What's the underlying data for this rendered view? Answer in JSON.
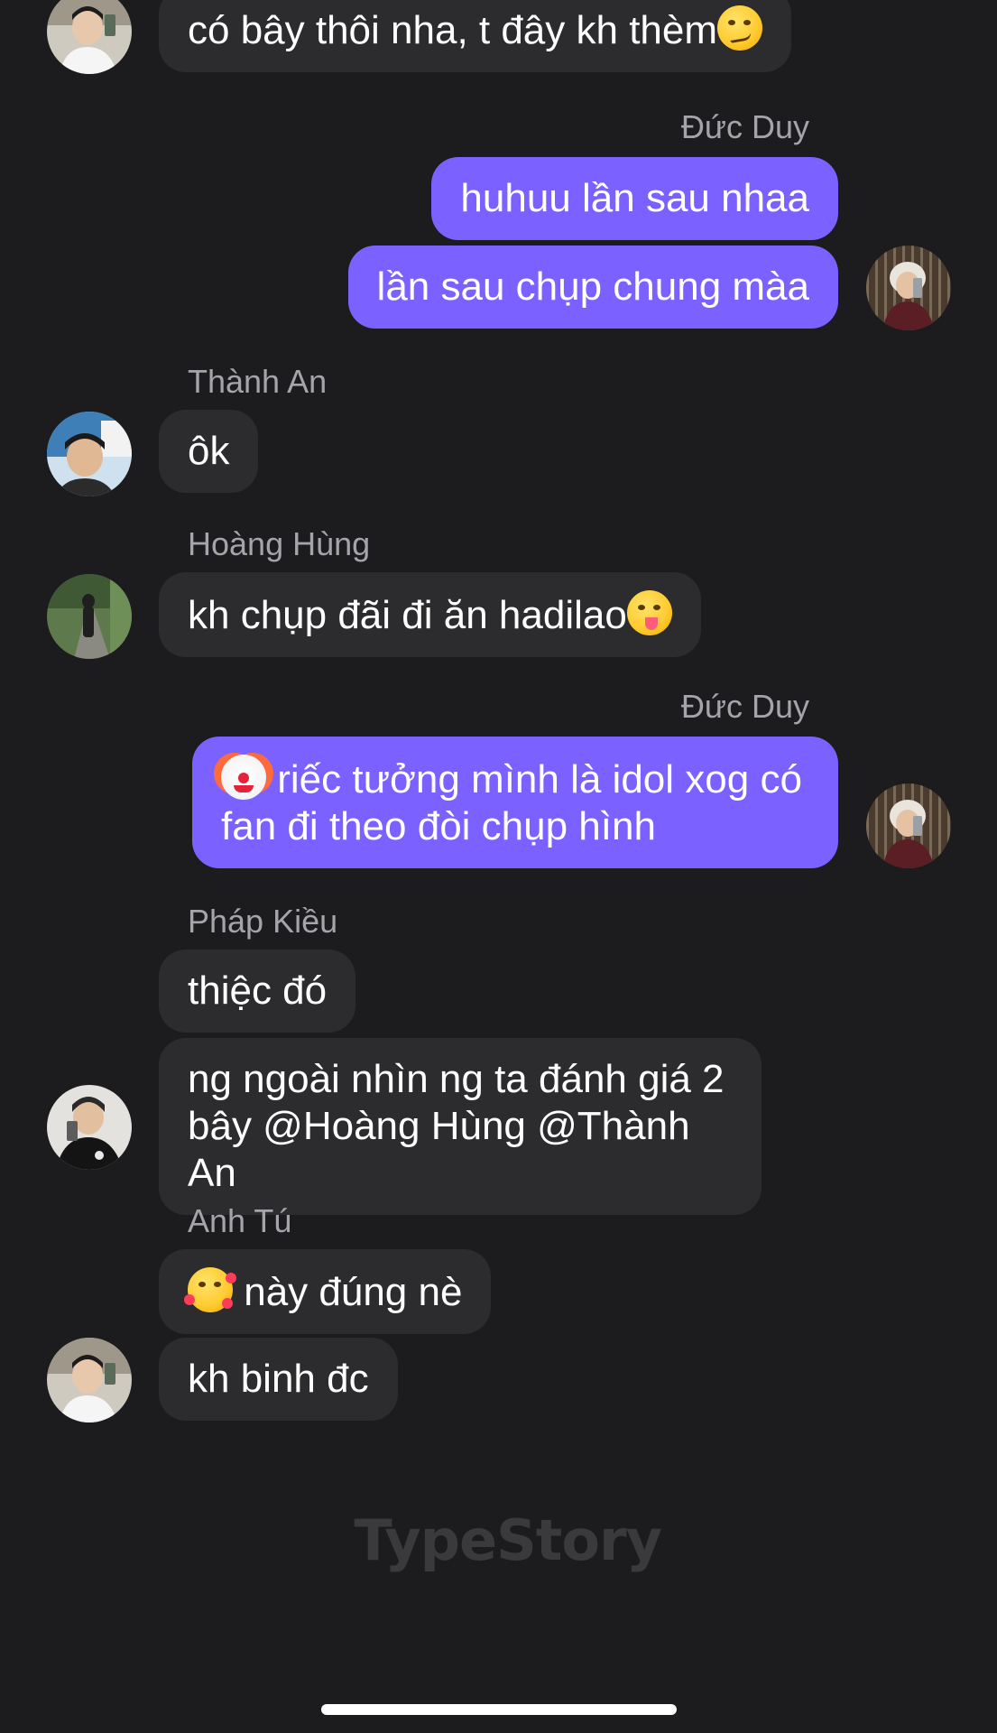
{
  "messages": [
    {
      "text": "có bây thôi nha, t đây kh thèm",
      "emoji": "smirking-face"
    },
    {
      "sender": "Đức Duy"
    },
    {
      "text": "huhuu lần sau nhaa"
    },
    {
      "text": "lần sau chụp chung màa"
    },
    {
      "sender": "Thành An"
    },
    {
      "text": "ôk"
    },
    {
      "sender": "Hoàng Hùng"
    },
    {
      "text": "kh chụp đãi đi ăn hadilao",
      "emoji": "face-savoring-food"
    },
    {
      "sender": "Đức Duy"
    },
    {
      "text": " riếc tưởng mình là idol xog có fan đi theo đòi chụp hình",
      "emoji": "clown-face"
    },
    {
      "sender": "Pháp Kiều"
    },
    {
      "text": "thiệc đó"
    },
    {
      "text": "ng ngoài nhìn ng ta đánh giá 2 bây @Hoàng Hùng @Thành An"
    },
    {
      "sender": "Anh Tú"
    },
    {
      "text": " này đúng nè",
      "emoji": "smiling-face-with-hearts"
    },
    {
      "text": "kh binh đc"
    }
  ],
  "watermark": "TypeStory",
  "colors": {
    "background": "#1c1c1e",
    "incoming_bubble": "#2c2c2e",
    "outgoing_bubble": "#7b61ff",
    "sender_label": "#a4a4aa"
  }
}
